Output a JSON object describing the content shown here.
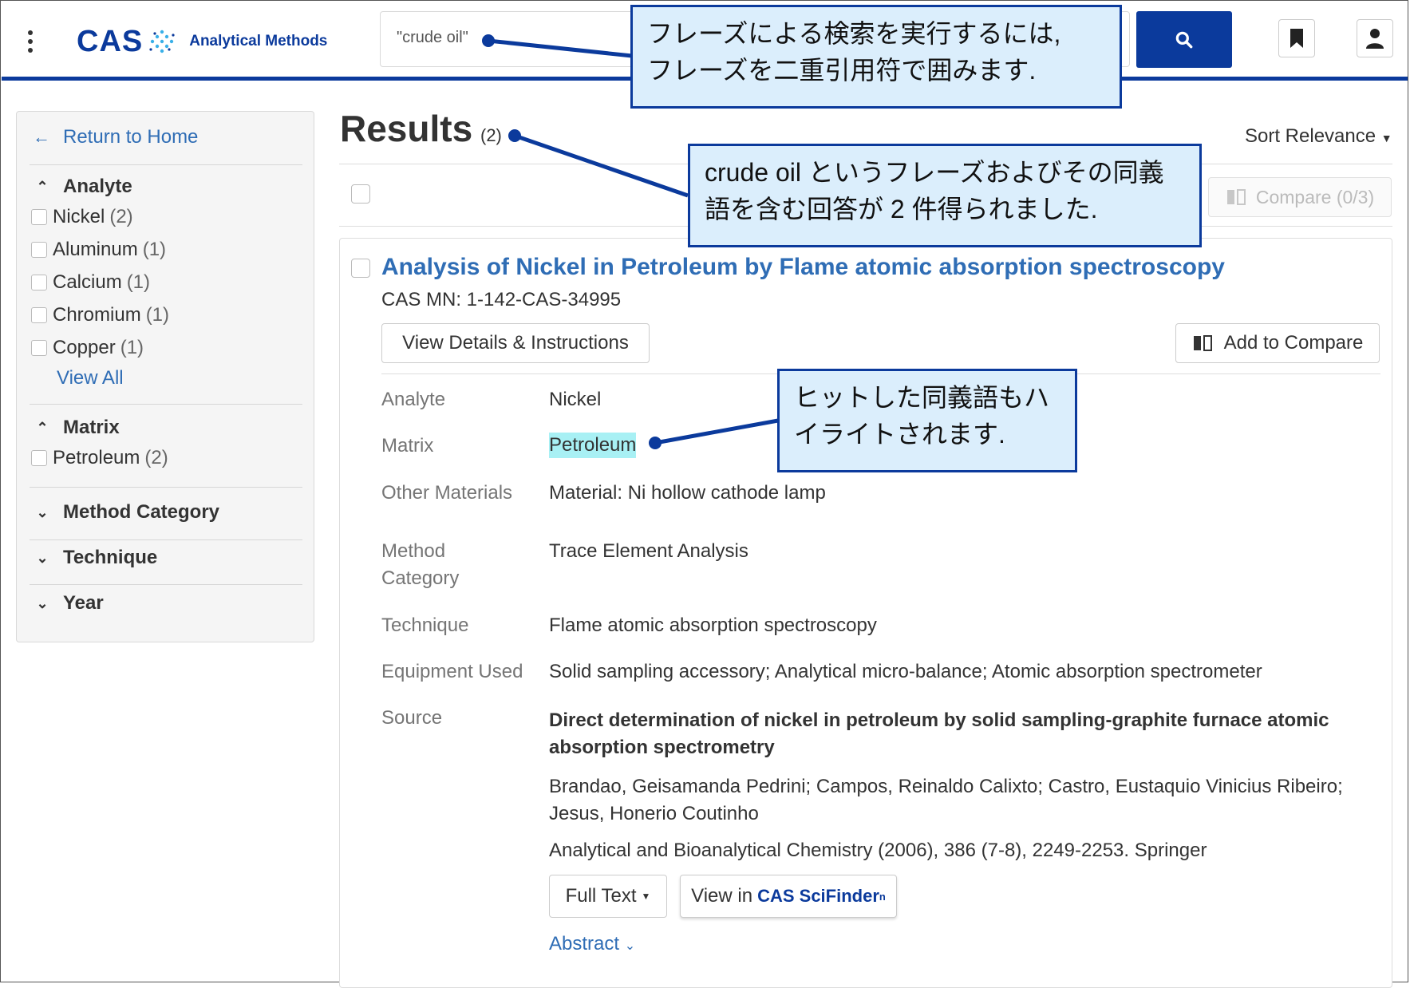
{
  "header": {
    "logo_text": "CAS",
    "logo_subtitle": "Analytical Methods",
    "search_value": "\"crude oil\"",
    "icons": [
      "menu-dots-icon",
      "search-icon",
      "bookmark-icon",
      "user-icon"
    ]
  },
  "sidebar": {
    "return_label": "Return to Home",
    "facets": {
      "analyte": {
        "title": "Analyte",
        "items": [
          {
            "label": "Nickel",
            "count": "(2)"
          },
          {
            "label": "Aluminum",
            "count": "(1)"
          },
          {
            "label": "Calcium",
            "count": "(1)"
          },
          {
            "label": "Chromium",
            "count": "(1)"
          },
          {
            "label": "Copper",
            "count": "(1)"
          }
        ],
        "view_all": "View All"
      },
      "matrix": {
        "title": "Matrix",
        "items": [
          {
            "label": "Petroleum",
            "count": "(2)"
          }
        ]
      },
      "method_category": {
        "title": "Method Category"
      },
      "technique": {
        "title": "Technique"
      },
      "year": {
        "title": "Year"
      }
    }
  },
  "results": {
    "title": "Results",
    "count": "(2)",
    "sort_label": "Sort Relevance",
    "compare_label": "Compare (0/3)"
  },
  "result": {
    "title": "Analysis of Nickel in Petroleum by Flame atomic absorption spectroscopy",
    "cas_mn": "CAS MN: 1-142-CAS-34995",
    "view_details": "View Details & Instructions",
    "add_compare": "Add to Compare",
    "fields": {
      "analyte": {
        "label": "Analyte",
        "value": "Nickel"
      },
      "matrix": {
        "label": "Matrix",
        "value": "Petroleum"
      },
      "other": {
        "label": "Other Materials",
        "value": "Material: Ni hollow cathode lamp"
      },
      "method_label_1": "Method",
      "method_label_2": "Category",
      "method_value": "Trace Element Analysis",
      "technique": {
        "label": "Technique",
        "value": "Flame atomic absorption spectroscopy"
      },
      "equipment": {
        "label": "Equipment Used",
        "value": "Solid sampling accessory; Analytical micro-balance; Atomic absorption spectrometer"
      },
      "source_label": "Source"
    },
    "source": {
      "title": "Direct determination of nickel in petroleum by solid sampling-graphite furnace atomic absorption spectrometry",
      "authors": "Brandao, Geisamanda Pedrini; Campos, Reinaldo Calixto; Castro, Eustaquio Vinicius Ribeiro; Jesus, Honerio Coutinho",
      "citation": "Analytical and Bioanalytical Chemistry (2006), 386 (7-8), 2249-2253. Springer"
    },
    "full_text": "Full Text",
    "view_in": "View in",
    "scifinder_brand": "CAS SciFinder",
    "scifinder_sup": "n",
    "abstract": "Abstract"
  },
  "callouts": {
    "phrase_line1": "フレーズによる検索を実行するには,",
    "phrase_line2": "フレーズを二重引用符で囲みます.",
    "results_line1": "crude oil というフレーズおよびその同義",
    "results_line2": "語を含む回答が 2 件得られました.",
    "synonym_line1": "ヒットした同義語もハ",
    "synonym_line2": "イライトされます."
  },
  "colors": {
    "brand_blue": "#0b3a9c",
    "link_blue": "#2f6db5",
    "callout_bg": "#dbeefc",
    "highlight": "#a8f0f4"
  }
}
